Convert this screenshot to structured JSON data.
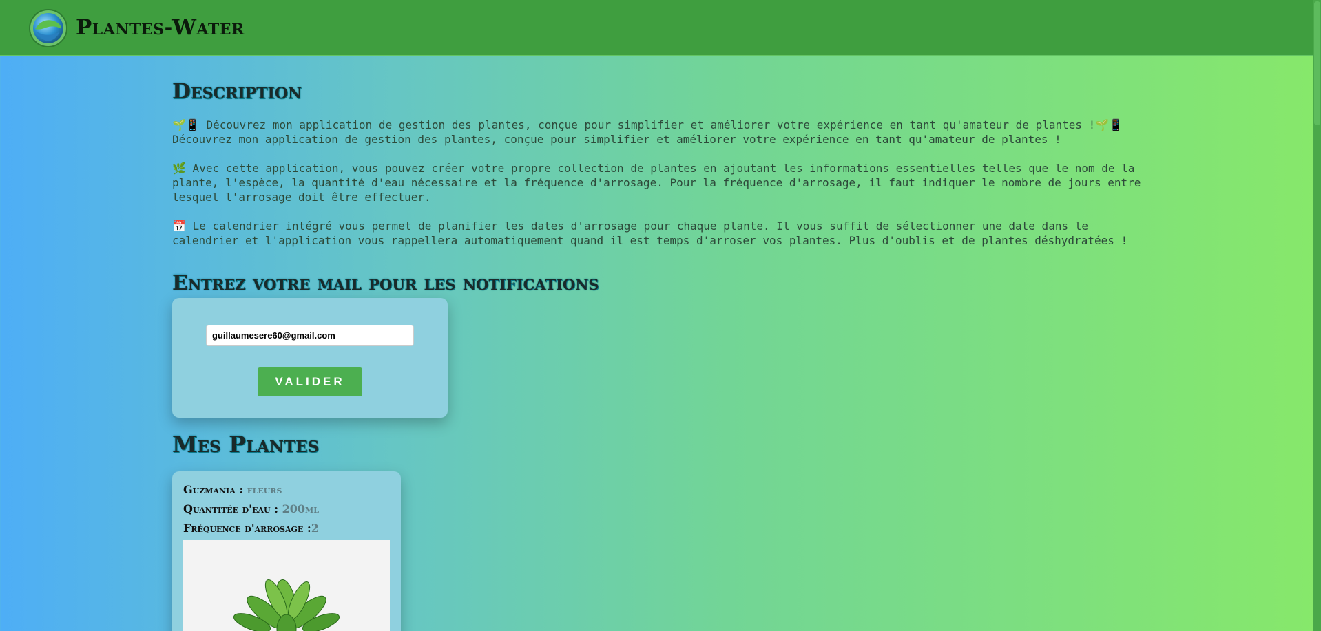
{
  "header": {
    "app_title": "Plantes-Water",
    "logo_icon": "globe-water-logo-icon"
  },
  "description": {
    "title": "Description",
    "paragraph1": "🌱📱 Découvrez mon application de gestion des plantes, conçue pour simplifier et améliorer votre expérience en tant qu'amateur de plantes !🌱📱\nDécouvrez mon application de gestion des plantes, conçue pour simplifier et améliorer votre expérience en tant qu'amateur de plantes !",
    "paragraph2": "🌿 Avec cette application, vous pouvez créer votre propre collection de plantes en ajoutant les informations essentielles telles que le nom de la\nplante, l'espèce, la quantité d'eau nécessaire et la fréquence d'arrosage. Pour la fréquence d'arrosage, il faut indiquer le nombre de jours entre\nlesquel l'arrosage doit être effectuer.",
    "paragraph3": "📅 Le calendrier intégré vous permet de planifier les dates d'arrosage pour chaque plante. Il vous suffit de sélectionner une date dans le\ncalendrier et l'application vous rappellera automatiquement quand il est temps d'arroser vos plantes. Plus d'oublis et de plantes déshydratées !"
  },
  "notifications": {
    "title": "Entrez votre mail pour les notifications",
    "email_value": "guillaumesere60@gmail.com",
    "submit_label": "VALIDER"
  },
  "plants": {
    "title": "Mes Plantes",
    "items": [
      {
        "name": "Guzmania",
        "species": "fleurs",
        "water_label": "Quantitée d'eau :",
        "water": "200ml",
        "frequency_label": "Fréquence d'arrosage :",
        "frequency": "2",
        "photo_icon": "potted-plant-photo"
      }
    ]
  },
  "colors": {
    "header": "#3f9e3f",
    "button": "#4caf50",
    "card": "#8fd0df",
    "gradient_start": "#4eaef6",
    "gradient_end": "#87e86a"
  }
}
